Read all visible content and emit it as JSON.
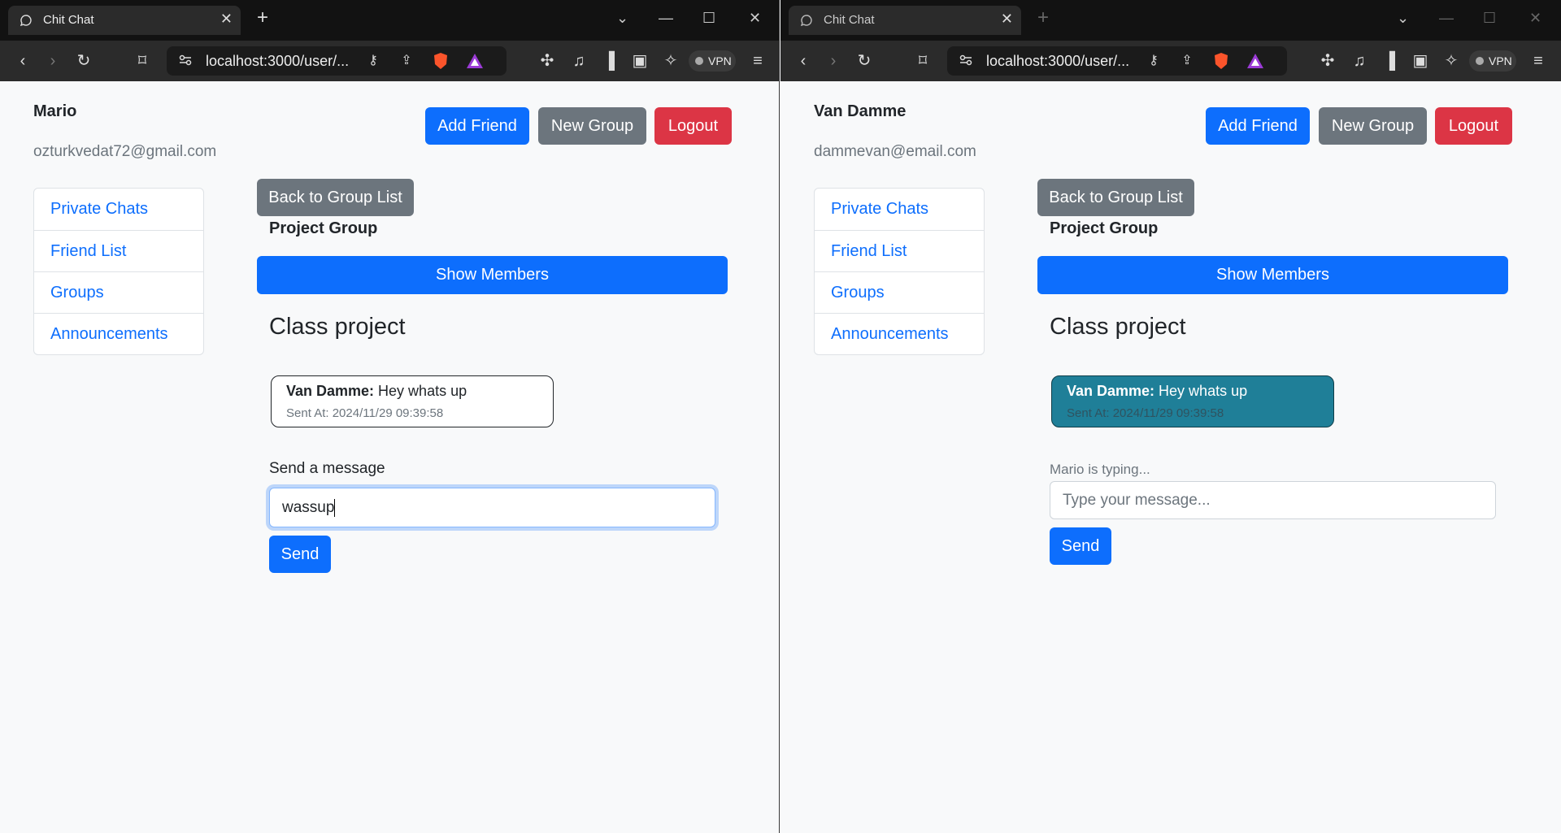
{
  "browser": {
    "left": {
      "tab_title": "Chit Chat",
      "tab_close": "✕",
      "new_tab": "+",
      "url": "localhost:3000/user/...",
      "vpn": "VPN"
    },
    "right": {
      "tab_title": "Chit Chat",
      "tab_close": "✕",
      "new_tab": "+",
      "url": "localhost:3000/user/...",
      "vpn": "VPN"
    },
    "controls": {
      "dropdown": "⌄",
      "minimize": "—",
      "maximize": "☐",
      "close": "✕"
    }
  },
  "header_buttons": {
    "add_friend": "Add Friend",
    "new_group": "New Group",
    "logout": "Logout"
  },
  "sidebar": {
    "items": [
      {
        "label": "Private Chats"
      },
      {
        "label": "Friend List"
      },
      {
        "label": "Groups"
      },
      {
        "label": "Announcements"
      }
    ]
  },
  "group": {
    "back_button": "Back to Group List",
    "name": "Project Group",
    "show_members": "Show Members",
    "chat_title": "Class project"
  },
  "message": {
    "sender": "Van Damme:",
    "text": " Hey whats up",
    "sent_at": "Sent At: 2024/11/29 09:39:58"
  },
  "left_user": {
    "name": "Mario",
    "email": "ozturkvedat72@gmail.com",
    "send_label": "Send a message",
    "input_value": "wassup",
    "send_button": "Send"
  },
  "right_user": {
    "name": "Van Damme",
    "email": "dammevan@email.com",
    "typing_indicator": "Mario is typing...",
    "input_placeholder": "Type your message...",
    "send_button": "Send"
  },
  "colors": {
    "primary": "#0d6efd",
    "secondary": "#6c757d",
    "danger": "#dc3545",
    "highlight_message": "#1f7f98"
  }
}
